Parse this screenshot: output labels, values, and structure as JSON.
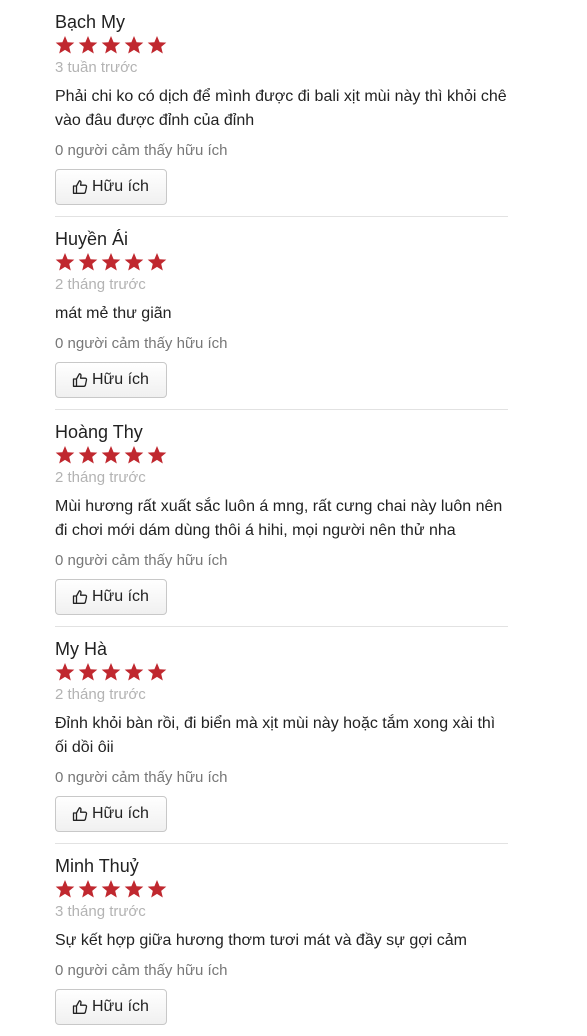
{
  "colors": {
    "star": "#c0282f",
    "time": "#b3b3b3",
    "muted": "#777777",
    "divider": "#e2e2e2"
  },
  "reviews": [
    {
      "name": "Bạch My",
      "rating": 5,
      "time": "3 tuần trước",
      "text": "Phải chi ko có dịch để mình được đi bali xịt mùi này thì khỏi chê vào đâu được đỉnh của đỉnh",
      "helpful_count": "0 người cảm thấy hữu ích",
      "helpful_button": "Hữu ích"
    },
    {
      "name": "Huyền Ái",
      "rating": 5,
      "time": "2 tháng trước",
      "text": "mát mẻ thư giãn",
      "helpful_count": "0 người cảm thấy hữu ích",
      "helpful_button": "Hữu ích"
    },
    {
      "name": "Hoàng Thy",
      "rating": 5,
      "time": "2 tháng trước",
      "text": "Mùi hương rất xuất sắc luôn á mng, rất cưng chai này luôn nên đi chơi mới dám dùng thôi á hihi, mọi người nên thử nha",
      "helpful_count": "0 người cảm thấy hữu ích",
      "helpful_button": "Hữu ích"
    },
    {
      "name": "My Hà",
      "rating": 5,
      "time": "2 tháng trước",
      "text": "Đỉnh khỏi bàn rồi, đi biển mà xịt mùi này hoặc tắm xong xài thì ối dồi ôii",
      "helpful_count": "0 người cảm thấy hữu ích",
      "helpful_button": "Hữu ích"
    },
    {
      "name": "Minh Thuỷ",
      "rating": 5,
      "time": "3 tháng trước",
      "text": "Sự kết hợp giữa hương thơm tươi mát và đầy sự gợi cảm",
      "helpful_count": "0 người cảm thấy hữu ích",
      "helpful_button": "Hữu ích"
    }
  ]
}
